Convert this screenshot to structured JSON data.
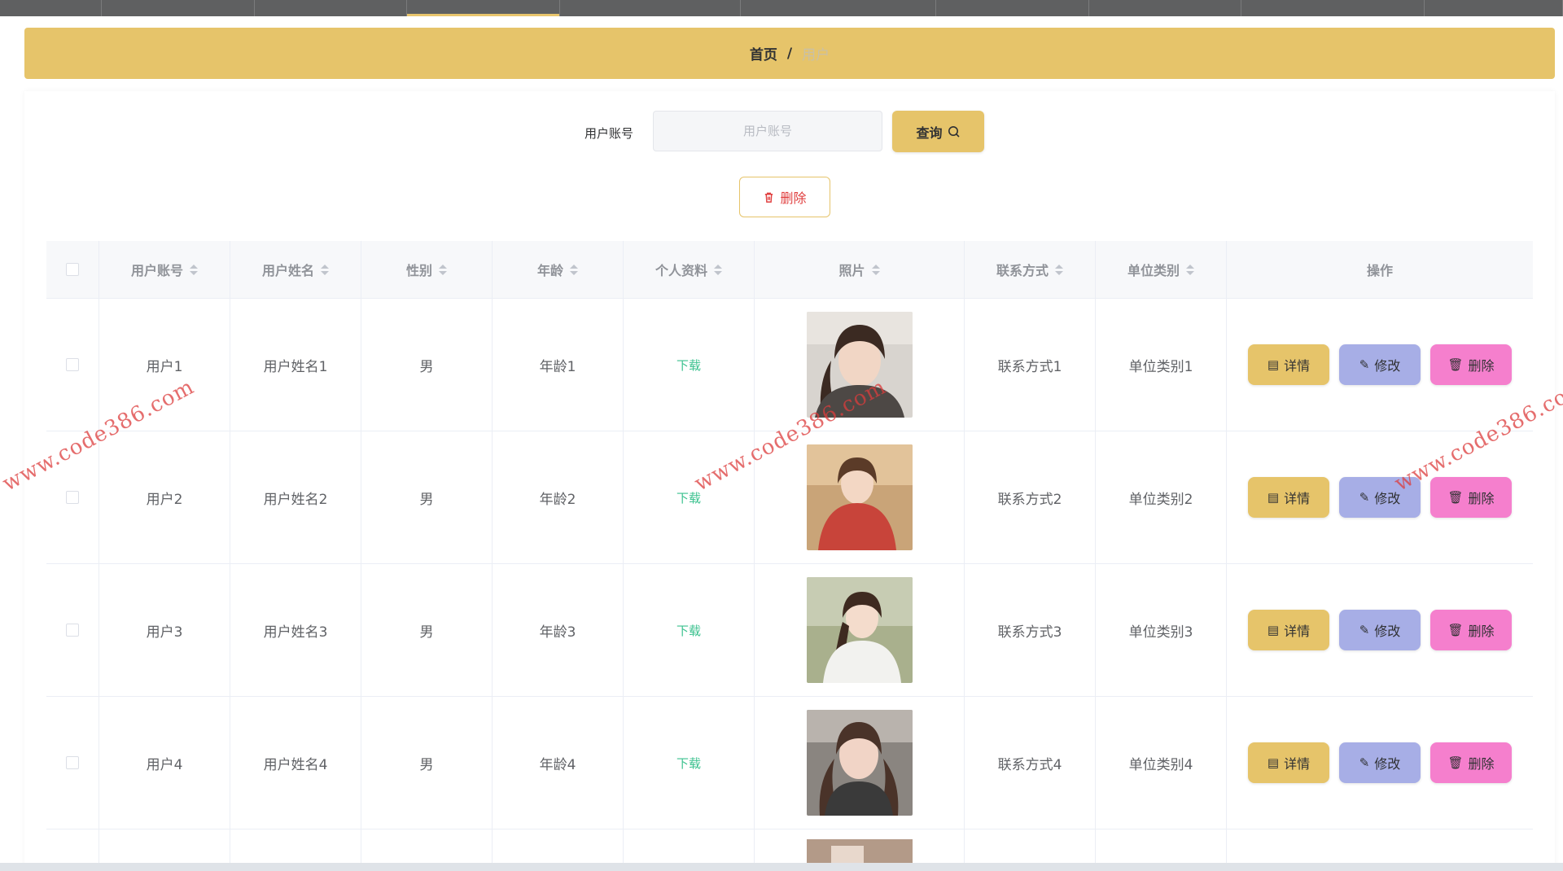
{
  "breadcrumb": {
    "home": "首页",
    "separator": "/",
    "current": "用户"
  },
  "search": {
    "label": "用户账号",
    "placeholder": "用户账号",
    "button_label": "查询"
  },
  "toolbar": {
    "delete_label": "删除"
  },
  "table": {
    "headers": [
      "用户账号",
      "用户姓名",
      "性别",
      "年龄",
      "个人资料",
      "照片",
      "联系方式",
      "单位类别",
      "操作"
    ],
    "rows": [
      {
        "account": "用户1",
        "name": "用户姓名1",
        "gender": "男",
        "age": "年龄1",
        "profile": "下载",
        "contact": "联系方式1",
        "unit": "单位类别1"
      },
      {
        "account": "用户2",
        "name": "用户姓名2",
        "gender": "男",
        "age": "年龄2",
        "profile": "下载",
        "contact": "联系方式2",
        "unit": "单位类别2"
      },
      {
        "account": "用户3",
        "name": "用户姓名3",
        "gender": "男",
        "age": "年龄3",
        "profile": "下载",
        "contact": "联系方式3",
        "unit": "单位类别3"
      },
      {
        "account": "用户4",
        "name": "用户姓名4",
        "gender": "男",
        "age": "年龄4",
        "profile": "下载",
        "contact": "联系方式4",
        "unit": "单位类别4"
      }
    ],
    "actions": {
      "detail": "详情",
      "edit": "修改",
      "delete": "删除"
    }
  },
  "watermark": "www.code386.com",
  "colors": {
    "accent": "#e6c46a",
    "edit": "#a7aee6",
    "delete": "#f57fcd",
    "download": "#3cc28f",
    "danger": "#e03e3e"
  }
}
